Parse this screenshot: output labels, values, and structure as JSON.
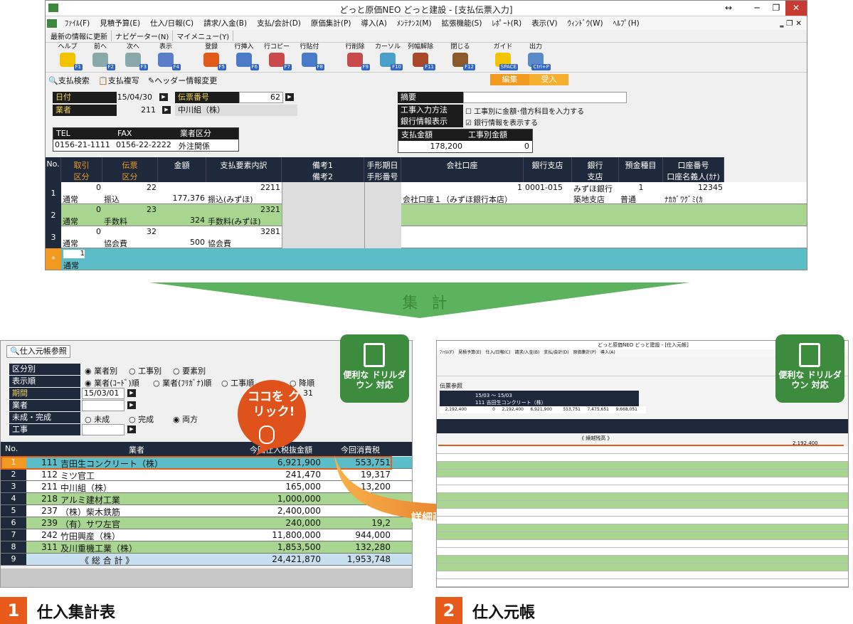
{
  "top_window": {
    "title": "どっと原価NEO どっと建設 - [支払伝票入力]",
    "menu": [
      "ﾌｧｲﾙ(F)",
      "見積予算(E)",
      "仕入/日報(C)",
      "請求/入金(B)",
      "支払/会計(D)",
      "原価集計(P)",
      "導入(A)",
      "ﾒﾝﾃﾅﾝｽ(M)",
      "拡張機能(S)",
      "ﾚﾎﾟｰﾄ(R)",
      "表示(V)",
      "ｳｨﾝﾄﾞｳ(W)",
      "ﾍﾙﾌﾟ(H)"
    ],
    "submenu": [
      "最新の情報に更新",
      "ナビゲーター(N)",
      "マイメニュー(Y)"
    ],
    "toolbar": [
      {
        "label": "ヘルプ",
        "key": "F1"
      },
      {
        "label": "前へ",
        "key": "F2"
      },
      {
        "label": "次へ",
        "key": "F3"
      },
      {
        "label": "表示",
        "key": "F4"
      },
      {
        "label": "登録",
        "key": "F5"
      },
      {
        "label": "行挿入",
        "key": "F6"
      },
      {
        "label": "行コピー",
        "key": "F7"
      },
      {
        "label": "行貼付",
        "key": "F8"
      },
      {
        "label": "行削除",
        "key": "F9"
      },
      {
        "label": "カーソル",
        "key": "F10"
      },
      {
        "label": "列幅解除",
        "key": "F11"
      },
      {
        "label": "閉じる",
        "key": "F12"
      },
      {
        "label": "ガイド",
        "key": "SPACE"
      },
      {
        "label": "出力",
        "key": "Ctrl+P"
      }
    ],
    "actions": [
      "支払検索",
      "支払複写",
      "ヘッダー情報変更"
    ],
    "mode_edit": "編集",
    "mode_receive": "受入",
    "date_label": "日付",
    "date_value": "15/04/30",
    "slip_label": "伝票番号",
    "slip_value": "62",
    "vendor_label": "業者",
    "vendor_code": "211",
    "vendor_name": "中川組（株）",
    "tel_label": "TEL",
    "tel_value": "0156-21-1111",
    "fax_label": "FAX",
    "fax_value": "0156-22-2222",
    "type_label": "業者区分",
    "type_value": "外注関係",
    "memo_label": "摘要",
    "method_label": "工事入力方法",
    "method_option": "工事別に金額･借方科目を入力する",
    "bank_label": "銀行情報表示",
    "bank_option": "銀行情報を表示する",
    "pay_total_label": "支払金額",
    "pay_total_value": "178,200",
    "job_total_label": "工事別金額",
    "job_total_value": "0"
  },
  "grid": {
    "headers": [
      {
        "l1": "No.",
        "l2": ""
      },
      {
        "l1": "取引",
        "l2": "区分"
      },
      {
        "l1": "伝票",
        "l2": "区分"
      },
      {
        "l1": "金額",
        "l2": ""
      },
      {
        "l1": "支払要素内訳",
        "l2": ""
      },
      {
        "l1": "備考1",
        "l2": "備考2"
      },
      {
        "l1": "手形期日",
        "l2": "手形番号"
      },
      {
        "l1": "会社口座",
        "l2": ""
      },
      {
        "l1": "銀行支店",
        "l2": ""
      },
      {
        "l1": "銀行",
        "l2": "支店"
      },
      {
        "l1": "預金種目",
        "l2": ""
      },
      {
        "l1": "口座番号",
        "l2": "口座名義人(ｶﾅ)"
      }
    ],
    "rows": [
      {
        "no": "1",
        "t1": "0",
        "t2": "通常",
        "s1": "22",
        "s2": "振込",
        "amt": "177,376",
        "e1": "2211",
        "e2": "振込(みずほ)",
        "acc1": "1",
        "acc2": "会社口座１（みずほ銀行本店）",
        "br": "0001-015",
        "bank1": "みずほ銀行",
        "bank2": "築地支店",
        "dep": "1",
        "dep2": "普通",
        "an1": "12345",
        "an2": "ﾅｶｶﾞﾜｸﾞﾐ(ｶ"
      },
      {
        "no": "2",
        "t1": "0",
        "t2": "通常",
        "s1": "23",
        "s2": "手数料",
        "amt": "324",
        "e1": "2321",
        "e2": "手数料(みずほ)",
        "acc1": "",
        "acc2": "",
        "br": "",
        "bank1": "",
        "bank2": "",
        "dep": "",
        "dep2": "",
        "an1": "",
        "an2": ""
      },
      {
        "no": "3",
        "t1": "0",
        "t2": "通常",
        "s1": "32",
        "s2": "協会費",
        "amt": "500",
        "e1": "3281",
        "e2": "協会費",
        "acc1": "",
        "acc2": "",
        "br": "",
        "bank1": "",
        "bank2": "",
        "dep": "",
        "dep2": "",
        "an1": "",
        "an2": ""
      }
    ],
    "new_row": {
      "no": "*",
      "t1": "1",
      "t2": "通常"
    }
  },
  "arrow_label": "集 計",
  "left_panel": {
    "title": "仕入元帳参照",
    "rows": [
      {
        "label": "区分別",
        "opts": [
          "業者別",
          "工事別",
          "要素別"
        ]
      },
      {
        "label": "表示順",
        "opts": [
          "業者(ｺｰﾄﾞ)順",
          "業者(ﾌﾘｶﾞﾅ)順",
          "工事順",
          "降順"
        ]
      },
      {
        "label": "期間",
        "value": "15/03/01",
        "value2": "31"
      },
      {
        "label": "業者"
      },
      {
        "label": "未成・完成",
        "opts": [
          "未成",
          "完成",
          "両方"
        ]
      },
      {
        "label": "工事"
      }
    ],
    "callout": "ココを クリック!",
    "table_headers": [
      "No.",
      "業者",
      "今回仕入税抜金額",
      "今回消費税"
    ],
    "table_rows": [
      {
        "no": "1",
        "code": "111",
        "name": "吉田生コンクリート（株）",
        "amt": "6,921,900",
        "tax": "553,751"
      },
      {
        "no": "2",
        "code": "112",
        "name": "ミツ官工",
        "amt": "241,470",
        "tax": "19,317"
      },
      {
        "no": "3",
        "code": "211",
        "name": "中川組（株）",
        "amt": "165,000",
        "tax": "13,200"
      },
      {
        "no": "4",
        "code": "218",
        "name": "アルミ建材工業",
        "amt": "1,000,000",
        "tax": ""
      },
      {
        "no": "5",
        "code": "237",
        "name": "（株）柴木鉄筋",
        "amt": "2,400,000",
        "tax": ""
      },
      {
        "no": "6",
        "code": "239",
        "name": "（有）サワ左官",
        "amt": "240,000",
        "tax": "19,2"
      },
      {
        "no": "7",
        "code": "242",
        "name": "竹田興産（株）",
        "amt": "11,800,000",
        "tax": "944,000"
      },
      {
        "no": "8",
        "code": "311",
        "name": "及川重機工業（株）",
        "amt": "1,853,500",
        "tax": "132,280"
      },
      {
        "no": "9",
        "code": "",
        "name": "《 総 合 計 》",
        "amt": "24,421,870",
        "tax": "1,953,748"
      }
    ]
  },
  "drilldown_label": "詳細画面を表示",
  "badge_text": "便利な ドリルダウン 対応",
  "right_panel": {
    "title": "どっと原価NEO どっと建設 - [仕入元帳]",
    "subtitle": "伝票参照",
    "period": "15/03 ～ 15/03",
    "vendor": "111 吉田生コンクリート（株）",
    "summary": [
      "2,192,400",
      "0",
      "2,192,400",
      "6,921,900",
      "553,751",
      "7,475,651",
      "9,668,051"
    ],
    "carry": "《 繰越残高 》",
    "carry_value": "2,192,400"
  },
  "caption1_num": "1",
  "caption1": "仕入集計表",
  "caption2_num": "2",
  "caption2": "仕入元帳"
}
